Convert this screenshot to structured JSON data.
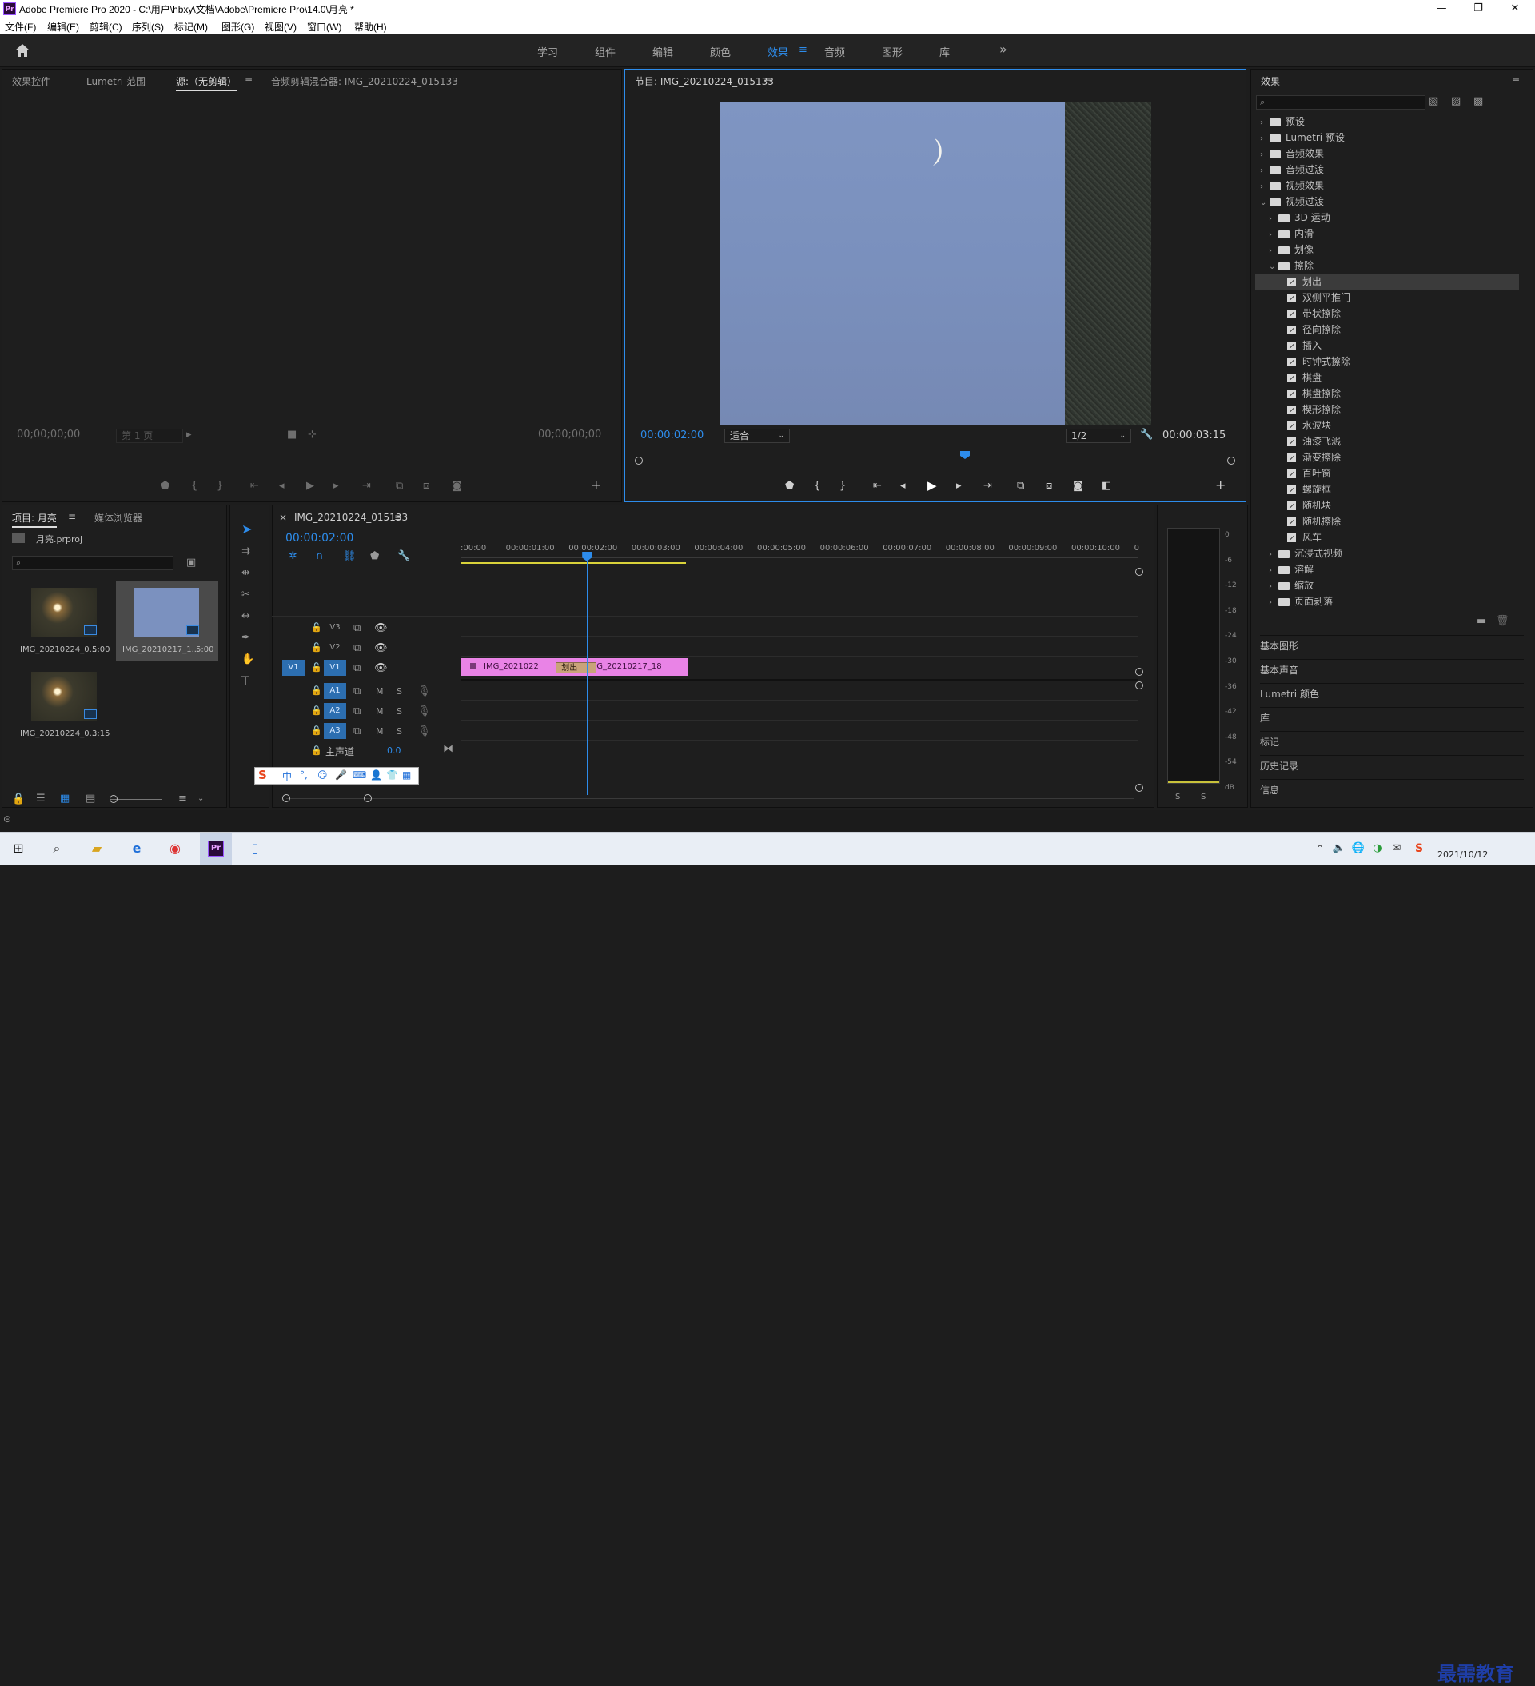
{
  "window": {
    "title": "Adobe Premiere Pro 2020 - C:\\用户\\hbxy\\文档\\Adobe\\Premiere Pro\\14.0\\月亮 *",
    "app_icon": "Pr",
    "controls": [
      "—",
      "❐",
      "✕"
    ]
  },
  "menu": [
    "文件(F)",
    "编辑(E)",
    "剪辑(C)",
    "序列(S)",
    "标记(M)",
    "图形(G)",
    "视图(V)",
    "窗口(W)",
    "帮助(H)"
  ],
  "workspaces": {
    "items": [
      "学习",
      "组件",
      "编辑",
      "颜色",
      "效果",
      "音频",
      "图形",
      "库"
    ],
    "active": "效果",
    "more": "»"
  },
  "source_panel": {
    "tabs": [
      "效果控件",
      "Lumetri 范围",
      "源:（无剪辑）",
      "音频剪辑混合器: IMG_20210224_015133"
    ],
    "active_tab": "源:（无剪辑）",
    "timecode_left": "00;00;00;00",
    "page_dropdown": "第 1 页",
    "timecode_right": "00;00;00;00"
  },
  "program_panel": {
    "title": "节目: IMG_20210224_015133",
    "timecode": "00:00:02:00",
    "fit_dropdown": "适合",
    "resolution_dropdown": "1/2",
    "duration": "00:00:03:15",
    "playhead_fraction": 0.55
  },
  "project_panel": {
    "tabs": [
      "项目: 月亮",
      "媒体浏览器"
    ],
    "file": "月亮.prproj",
    "items": [
      {
        "name": "IMG_20210224_0...",
        "duration": "5:00"
      },
      {
        "name": "IMG_20210217_1...",
        "duration": "5:00"
      },
      {
        "name": "IMG_20210224_0...",
        "duration": "3:15"
      }
    ]
  },
  "timeline": {
    "sequence_tab": "IMG_20210224_015133",
    "close": "×",
    "timecode": "00:00:02:00",
    "ruler": [
      ":00:00",
      "00:00:01:00",
      "00:00:02:00",
      "00:00:03:00",
      "00:00:04:00",
      "00:00:05:00",
      "00:00:06:00",
      "00:00:07:00",
      "00:00:08:00",
      "00:00:09:00",
      "00:00:10:00",
      "0"
    ],
    "video_tracks": [
      "V3",
      "V2",
      "V1"
    ],
    "source_patch": "V1",
    "audio_tracks": [
      "A1",
      "A2",
      "A3"
    ],
    "mute": "M",
    "solo": "S",
    "master_label": "主声道",
    "master_value": "0.0",
    "clips": [
      {
        "label": "IMG_2021022",
        "start": 0,
        "end": 1.65
      },
      {
        "label": "IMG_20210217_18",
        "start": 1.65,
        "end": 3.6
      }
    ],
    "transition": {
      "label": "划出",
      "start": 1.25,
      "end": 2.15
    },
    "playhead_seconds": 2.0
  },
  "audio_meter": {
    "db_labels": [
      "0",
      "-6",
      "-12",
      "-18",
      "-24",
      "-30",
      "-36",
      "-42",
      "-48",
      "-54",
      "dB"
    ],
    "solo_buttons": [
      "S",
      "S"
    ]
  },
  "effects_panel": {
    "title": "效果",
    "search_placeholder": "",
    "tree": [
      {
        "label": "预设",
        "level": 0,
        "kind": "folder",
        "open": false
      },
      {
        "label": "Lumetri 预设",
        "level": 0,
        "kind": "folder",
        "open": false
      },
      {
        "label": "音频效果",
        "level": 0,
        "kind": "folder",
        "open": false
      },
      {
        "label": "音频过渡",
        "level": 0,
        "kind": "folder",
        "open": false
      },
      {
        "label": "视频效果",
        "level": 0,
        "kind": "folder",
        "open": false
      },
      {
        "label": "视频过渡",
        "level": 0,
        "kind": "folder",
        "open": true
      },
      {
        "label": "3D 运动",
        "level": 1,
        "kind": "folder",
        "open": false
      },
      {
        "label": "内滑",
        "level": 1,
        "kind": "folder",
        "open": false
      },
      {
        "label": "划像",
        "level": 1,
        "kind": "folder",
        "open": false
      },
      {
        "label": "擦除",
        "level": 1,
        "kind": "folder",
        "open": true
      },
      {
        "label": "划出",
        "level": 2,
        "kind": "fx",
        "selected": true
      },
      {
        "label": "双侧平推门",
        "level": 2,
        "kind": "fx"
      },
      {
        "label": "带状擦除",
        "level": 2,
        "kind": "fx"
      },
      {
        "label": "径向擦除",
        "level": 2,
        "kind": "fx"
      },
      {
        "label": "插入",
        "level": 2,
        "kind": "fx"
      },
      {
        "label": "时钟式擦除",
        "level": 2,
        "kind": "fx"
      },
      {
        "label": "棋盘",
        "level": 2,
        "kind": "fx"
      },
      {
        "label": "棋盘擦除",
        "level": 2,
        "kind": "fx"
      },
      {
        "label": "楔形擦除",
        "level": 2,
        "kind": "fx"
      },
      {
        "label": "水波块",
        "level": 2,
        "kind": "fx"
      },
      {
        "label": "油漆飞溅",
        "level": 2,
        "kind": "fx"
      },
      {
        "label": "渐变擦除",
        "level": 2,
        "kind": "fx"
      },
      {
        "label": "百叶窗",
        "level": 2,
        "kind": "fx"
      },
      {
        "label": "螺旋框",
        "level": 2,
        "kind": "fx"
      },
      {
        "label": "随机块",
        "level": 2,
        "kind": "fx"
      },
      {
        "label": "随机擦除",
        "level": 2,
        "kind": "fx"
      },
      {
        "label": "风车",
        "level": 2,
        "kind": "fx"
      },
      {
        "label": "沉浸式视频",
        "level": 1,
        "kind": "folder",
        "open": false
      },
      {
        "label": "溶解",
        "level": 1,
        "kind": "folder",
        "open": false
      },
      {
        "label": "缩放",
        "level": 1,
        "kind": "folder",
        "open": false
      },
      {
        "label": "页面剥落",
        "level": 1,
        "kind": "folder",
        "open": false
      }
    ],
    "sections": [
      "基本图形",
      "基本声音",
      "Lumetri 颜色",
      "库",
      "标记",
      "历史记录",
      "信息"
    ]
  },
  "ime_bar": {
    "items": [
      "S",
      "中",
      "°,",
      "☺",
      "🎤",
      "⌨",
      "👤",
      "👕",
      "▦"
    ]
  },
  "taskbar": {
    "date": "2021/10/12",
    "watermark": "最需教育"
  },
  "colors": {
    "accent": "#2d8ceb",
    "clip_pink": "#e983e6",
    "transition": "#c9a37a",
    "track_blue": "#2c6eb0"
  }
}
